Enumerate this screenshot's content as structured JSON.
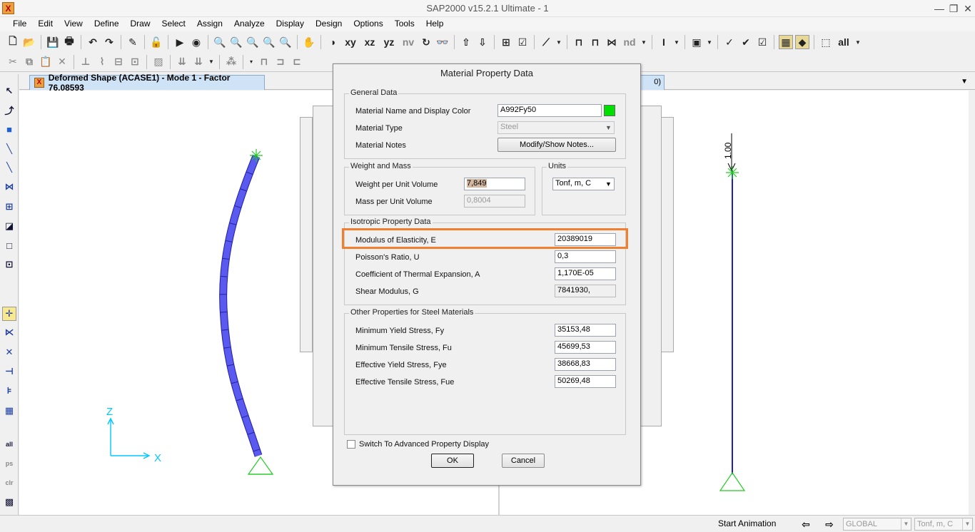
{
  "window": {
    "title": "SAP2000 v15.2.1 Ultimate  - 1",
    "app_icon": "X",
    "controls": [
      "—",
      "❐",
      "✕"
    ]
  },
  "menu": [
    "File",
    "Edit",
    "View",
    "Define",
    "Draw",
    "Select",
    "Assign",
    "Analyze",
    "Display",
    "Design",
    "Options",
    "Tools",
    "Help"
  ],
  "toolbar": {
    "view_labels": [
      "xy",
      "xz",
      "yz",
      "nv"
    ],
    "nd_label": "nd",
    "all_label": "all"
  },
  "left_toolbar": {
    "labels": [
      "all",
      "ps",
      "clr"
    ]
  },
  "tabs": {
    "active": "Deformed Shape (ACASE1) - Mode 1 - Factor 76,08593",
    "secondary": "0)"
  },
  "canvas": {
    "axis_z": "Z",
    "axis_x": "X",
    "load_value": "1.00",
    "colors": {
      "frame_deformed": "#4444ee",
      "frame_right": "#2020c0",
      "support": "#22cc22",
      "axis": "#00c8ff"
    }
  },
  "dialog": {
    "title": "Material Property Data",
    "general": {
      "title": "General Data",
      "name_label": "Material Name and Display Color",
      "name_value": "A992Fy50",
      "color": "#00e000",
      "type_label": "Material Type",
      "type_value": "Steel",
      "notes_label": "Material Notes",
      "notes_button": "Modify/Show Notes..."
    },
    "weight": {
      "title": "Weight and Mass",
      "wpuv_label": "Weight per Unit Volume",
      "wpuv_value": "7,849",
      "mpuv_label": "Mass per Unit Volume",
      "mpuv_value": "0,8004"
    },
    "units": {
      "title": "Units",
      "value": "Tonf, m, C"
    },
    "isotropic": {
      "title": "Isotropic Property Data",
      "e_label": "Modulus of Elasticity,  E",
      "e_value": "20389019",
      "u_label": "Poisson's Ratio,  U",
      "u_value": "0,3",
      "a_label": "Coefficient of Thermal Expansion,  A",
      "a_value": "1,170E-05",
      "g_label": "Shear Modulus,  G",
      "g_value": "7841930,"
    },
    "steel": {
      "title": "Other Properties for Steel Materials",
      "fy_label": "Minimum Yield Stress, Fy",
      "fy_value": "35153,48",
      "fu_label": "Minimum Tensile Stress, Fu",
      "fu_value": "45699,53",
      "fye_label": "Effective Yield Stress, Fye",
      "fye_value": "38668,83",
      "fue_label": "Effective Tensile Stress, Fue",
      "fue_value": "50269,48"
    },
    "advanced_label": "Switch To Advanced Property Display",
    "ok_label": "OK",
    "cancel_label": "Cancel"
  },
  "status": {
    "animation": "Start Animation",
    "coord_system": "GLOBAL",
    "units": "Tonf, m, C"
  }
}
